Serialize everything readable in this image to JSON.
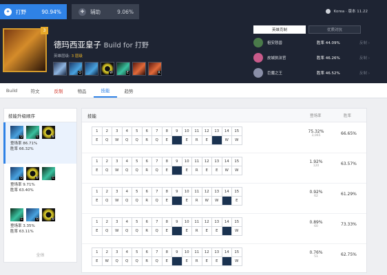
{
  "roles": [
    {
      "label": "打野",
      "pct": "90.94%",
      "icon": "jungle-icon"
    },
    {
      "label": "辅助",
      "pct": "9.06%",
      "icon": "support-icon"
    }
  ],
  "version": "Korea · 版本 11.22",
  "champion": {
    "name": "德玛西亚皇子",
    "suffix": "Build for 打野",
    "tier_label": "英雄层级:",
    "tier_value": "3 层级",
    "badge": "3"
  },
  "hero_skills": [
    {
      "key": "",
      "c": "p"
    },
    {
      "key": "Q",
      "c": "q"
    },
    {
      "key": "",
      "c": "q"
    },
    {
      "key": "W",
      "c": "w"
    },
    {
      "key": "E",
      "c": "e"
    },
    {
      "key": "",
      "c": "r"
    },
    {
      "key": "R",
      "c": "r"
    }
  ],
  "counter": {
    "tab_active": "英雄克制",
    "tab_other": "优质对抗",
    "rows": [
      {
        "name": "祖安怒兽",
        "wr": "胜率 44.09%",
        "rt": "反制 ›",
        "color": "#4a7a4a"
      },
      {
        "name": "皮城执法官",
        "wr": "胜率 46.26%",
        "rt": "反制 ›",
        "color": "#c85a8a"
      },
      {
        "name": "巨魔之王",
        "wr": "胜率 46.52%",
        "rt": "反制 ›",
        "color": "#8a8fa8"
      }
    ]
  },
  "nav": [
    "Build",
    "符文",
    "反制",
    "物品",
    "技能",
    "趋势"
  ],
  "left": {
    "title": "技能升级顺序",
    "more": "全体",
    "orders": [
      {
        "icons": [
          {
            "c": "q",
            "k": "Q"
          },
          {
            "c": "e",
            "k": "E"
          },
          {
            "c": "w",
            "k": "W"
          }
        ],
        "rate_label": "登场率",
        "rate": "86.71%",
        "win_label": "胜率",
        "win": "66.32%"
      },
      {
        "icons": [
          {
            "c": "q",
            "k": "Q"
          },
          {
            "c": "w",
            "k": "W"
          },
          {
            "c": "e",
            "k": "E"
          }
        ],
        "rate_label": "登场率",
        "rate": "9.71%",
        "win_label": "胜率",
        "win": "63.40%"
      },
      {
        "icons": [
          {
            "c": "e",
            "k": "E"
          },
          {
            "c": "q",
            "k": "Q"
          },
          {
            "c": "w",
            "k": "W"
          }
        ],
        "rate_label": "登场率",
        "rate": "3.35%",
        "win_label": "胜率",
        "win": "63.11%"
      }
    ]
  },
  "main": {
    "title": "技能",
    "col_rate": "登场率",
    "col_win": "胜率",
    "numbers": [
      "1",
      "2",
      "3",
      "4",
      "5",
      "6",
      "7",
      "8",
      "9",
      "10",
      "11",
      "12",
      "13",
      "14",
      "15"
    ],
    "builds": [
      {
        "seq": [
          "E",
          "Q",
          "W",
          "Q",
          "Q",
          "R",
          "Q",
          "E",
          "@q",
          "E",
          "R",
          "E",
          "@e",
          "W",
          "W"
        ],
        "rate": "75.32%",
        "games": "3,065",
        "win": "66.65%"
      },
      {
        "seq": [
          "E",
          "Q",
          "W",
          "Q",
          "Q",
          "R",
          "Q",
          "E",
          "@q",
          "E",
          "R",
          "E",
          "E",
          "W",
          "W"
        ],
        "rate": "1.92%",
        "games": "120",
        "win": "63.57%"
      },
      {
        "seq": [
          "E",
          "Q",
          "W",
          "Q",
          "Q",
          "R",
          "Q",
          "E",
          "@q",
          "E",
          "R",
          "W",
          "W",
          "@e",
          "E"
        ],
        "rate": "0.92%",
        "games": "62",
        "win": "61.29%"
      },
      {
        "seq": [
          "E",
          "Q",
          "W",
          "Q",
          "Q",
          "R",
          "Q",
          "E",
          "@q",
          "E",
          "R",
          "E",
          "E",
          "@e",
          "W"
        ],
        "rate": "0.89%",
        "games": "60",
        "win": "73.33%"
      },
      {
        "seq": [
          "E",
          "W",
          "Q",
          "Q",
          "Q",
          "R",
          "Q",
          "E",
          "@q",
          "E",
          "R",
          "E",
          "E",
          "@e",
          "W"
        ],
        "rate": "0.76%",
        "games": "51",
        "win": "62.75%"
      }
    ]
  }
}
